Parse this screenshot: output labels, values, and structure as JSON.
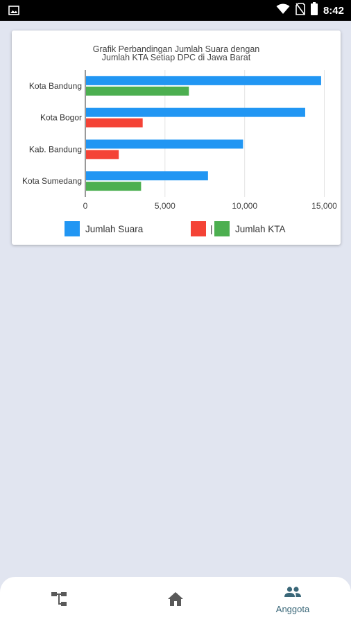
{
  "status_bar": {
    "time": "8:42",
    "icons": [
      "image-icon",
      "wifi-icon",
      "no-sim-icon",
      "battery-icon"
    ]
  },
  "chart_data": {
    "type": "bar",
    "orientation": "horizontal",
    "title": "Grafik Perbandingan Jumlah Suara dengan Jumlah KTA Setiap DPC di Jawa Barat",
    "title_lines": [
      "Grafik Perbandingan Jumlah Suara dengan",
      "Jumlah KTA Setiap DPC di Jawa Barat"
    ],
    "categories": [
      "Kota Bandung",
      "Kota Bogor",
      "Kab. Bandung",
      "Kota Sumedang"
    ],
    "series": [
      {
        "name": "Jumlah Suara",
        "color": "#2196f3",
        "values": [
          14800,
          13800,
          9900,
          7700
        ]
      },
      {
        "name": "Jumlah KTA",
        "colors": [
          "#4caf50",
          "#f44336",
          "#f44336",
          "#4caf50"
        ],
        "values": [
          6500,
          3600,
          2100,
          3500
        ]
      }
    ],
    "xlim": [
      0,
      15500
    ],
    "x_ticks": [
      0,
      5000,
      10000,
      15000
    ],
    "x_tick_labels": [
      "0",
      "5,000",
      "10,000",
      "15,000"
    ],
    "grid": true,
    "legend": {
      "placement": "bottom",
      "entries": [
        {
          "label": "Jumlah Suara",
          "colors": [
            "#2196f3"
          ]
        },
        {
          "label": "| ",
          "colors": [
            "#f44336"
          ]
        },
        {
          "label": "Jumlah KTA",
          "colors": [
            "#4caf50"
          ]
        }
      ]
    }
  },
  "bottom_nav": {
    "items": [
      {
        "icon": "hierarchy-icon",
        "label": "",
        "active": false
      },
      {
        "icon": "home-icon",
        "label": "",
        "active": false
      },
      {
        "icon": "people-icon",
        "label": "Anggota",
        "active": true
      }
    ]
  },
  "colors": {
    "background": "#e1e5f0",
    "nav_active": "#3a6778",
    "nav_inactive": "#595959"
  }
}
